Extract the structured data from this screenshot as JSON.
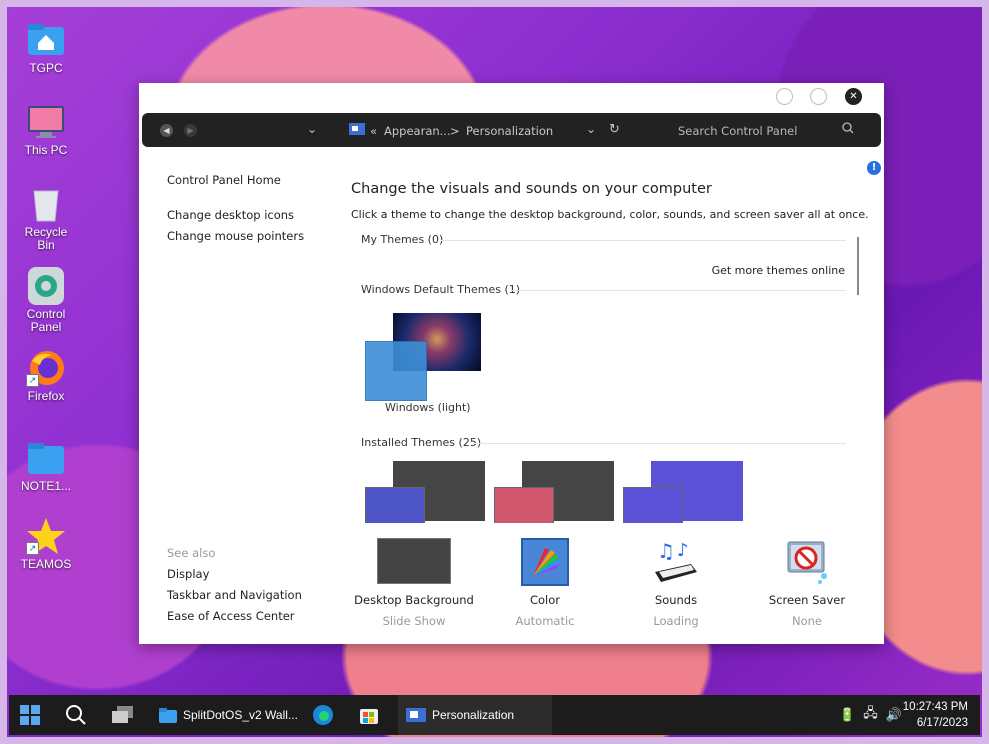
{
  "desktop": {
    "icons": [
      {
        "label": "TGPC"
      },
      {
        "label": "This PC"
      },
      {
        "label": "Recycle Bin"
      },
      {
        "label": "Control Panel"
      },
      {
        "label": "Firefox"
      },
      {
        "label": "NOTE1..."
      },
      {
        "label": "TEAMOS"
      }
    ]
  },
  "window": {
    "address": {
      "crumb_prefix": "«",
      "crumb1": "Appearan...",
      "separator": ">",
      "crumb2": "Personalization",
      "search_placeholder": "Search Control Panel"
    },
    "leftnav": {
      "home": "Control Panel Home",
      "desktop_icons": "Change desktop icons",
      "mouse_pointers": "Change mouse pointers"
    },
    "see_also": {
      "title": "See also",
      "display": "Display",
      "taskbar": "Taskbar and Navigation",
      "ease": "Ease of Access Center"
    },
    "heading": "Change the visuals and sounds on your computer",
    "subheading": "Click a theme to change the desktop background, color, sounds, and screen saver all at once.",
    "themes": {
      "my_themes": "My Themes (0)",
      "get_more": "Get more themes online",
      "default_themes": "Windows Default Themes (1)",
      "default_theme_name": "Windows (light)",
      "installed": "Installed Themes (25)",
      "installed_accents": [
        "#4f57c8",
        "#d0576e",
        "#5b52d8"
      ]
    },
    "bottom": [
      {
        "label": "Desktop Background",
        "sub": "Slide Show"
      },
      {
        "label": "Color",
        "sub": "Automatic"
      },
      {
        "label": "Sounds",
        "sub": "Loading"
      },
      {
        "label": "Screen Saver",
        "sub": "None"
      }
    ]
  },
  "taskbar": {
    "apps": [
      {
        "label": "SplitDotOS_v2 Wall..."
      },
      {
        "label": "Personalization"
      }
    ],
    "time": "10:27:43 PM",
    "date": "6/17/2023"
  },
  "colors": {
    "accent": "#2a6fe0",
    "taskbar": "#1c1c1c",
    "navbar": "#222222"
  }
}
